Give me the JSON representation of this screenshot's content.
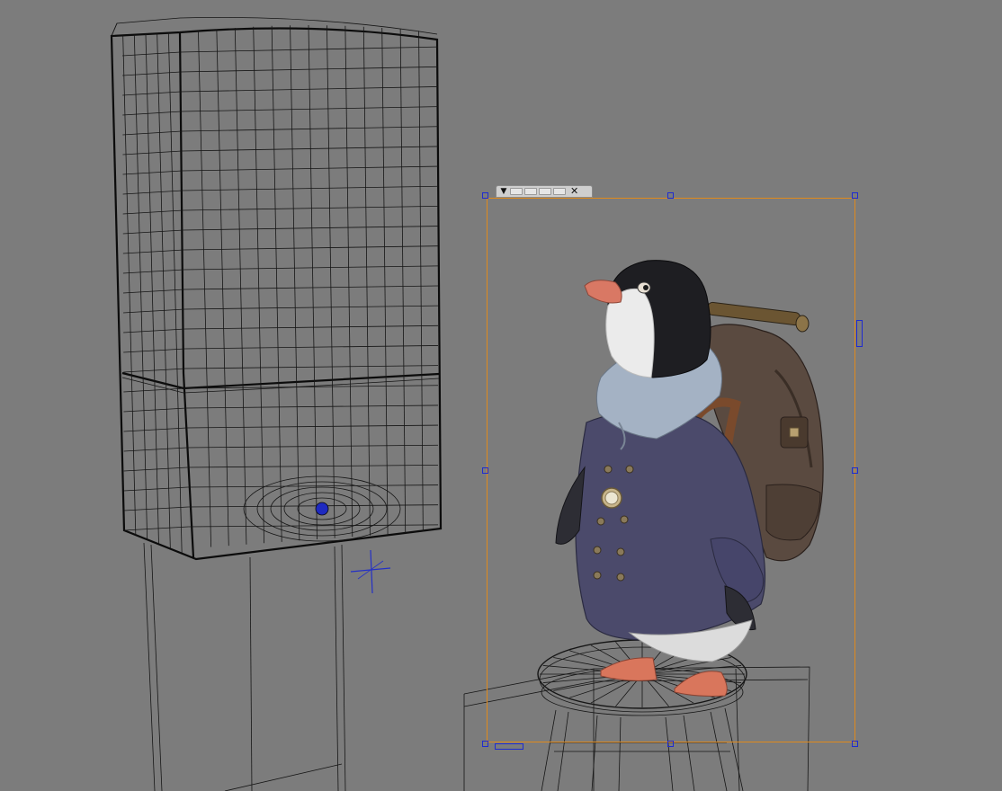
{
  "viewport": {
    "label": "3D viewport",
    "background": "#7c7c7c",
    "wire_color": "#161616"
  },
  "ipr_region": {
    "border_color": "#e08a1c",
    "handle_color": "#1f2bd0",
    "toolbar": {
      "menu_icon": "▼",
      "button_count": 4,
      "close_icon": "✕"
    }
  },
  "scene": {
    "objects": [
      "cabinet-wireframe",
      "penguin-character-render",
      "stool-wireframe",
      "crate-wireframe"
    ],
    "locator": "move-locator-crosshair"
  }
}
